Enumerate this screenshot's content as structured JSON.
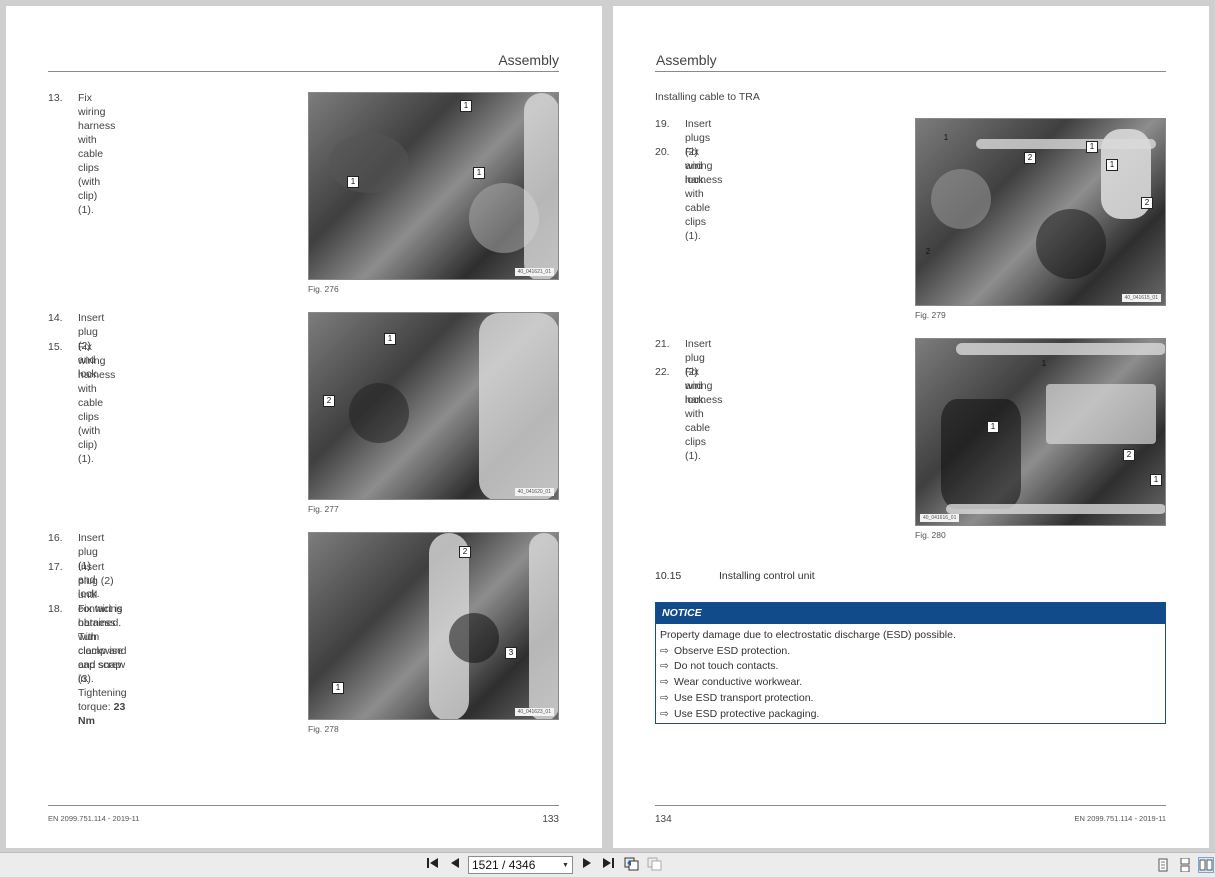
{
  "left_page": {
    "header": "Assembly",
    "steps": [
      {
        "num": "13.",
        "lines": [
          "Fix wiring harness with cable clips (with clip)",
          "(1)."
        ]
      },
      {
        "num": "14.",
        "lines": [
          "Insert plug (2) and lock."
        ]
      },
      {
        "num": "15.",
        "lines": [
          "Fix wiring harness with cable clips (with clip)",
          "(1)."
        ]
      },
      {
        "num": "16.",
        "lines": [
          "Insert plug (1) and lock."
        ]
      },
      {
        "num": "17.",
        "lines": [
          "Insert plug (2) until contact is obtained. Turn",
          "clockwise and snap in."
        ]
      },
      {
        "num": "18.",
        "lines": [
          "Fix wiring harness with clamp and cap screw",
          "(3)."
        ]
      }
    ],
    "torque_label": "Tightening torque: ",
    "torque_value": "23 Nm",
    "figures": [
      {
        "caption": "Fig. 276",
        "code": "40_041621_01",
        "callouts": [
          "1",
          "1",
          "1"
        ]
      },
      {
        "caption": "Fig. 277",
        "code": "40_041620_01",
        "callouts": [
          "1",
          "2"
        ]
      },
      {
        "caption": "Fig. 278",
        "code": "40_041623_01",
        "callouts": [
          "2",
          "3",
          "1"
        ]
      }
    ],
    "footer_doc": "EN 2099.751.114 - 2019-11",
    "footer_page": "133"
  },
  "right_page": {
    "header": "Assembly",
    "subhead": "Installing cable to TRA",
    "steps": [
      {
        "num": "19.",
        "lines": [
          "Insert plugs (2) and lock."
        ]
      },
      {
        "num": "20.",
        "lines": [
          "Fix wiring harness with cable clips (1)."
        ]
      },
      {
        "num": "21.",
        "lines": [
          "Insert plug (2) and lock."
        ]
      },
      {
        "num": "22.",
        "lines": [
          "Fix wiring harness with cable clips (1)."
        ]
      }
    ],
    "figures": [
      {
        "caption": "Fig. 279",
        "code": "40_041615_01",
        "callouts": [
          "1",
          "2",
          "1",
          "1",
          "2",
          "2"
        ]
      },
      {
        "caption": "Fig. 280",
        "code": "40_041616_01",
        "callouts": [
          "1",
          "1",
          "2",
          "1"
        ]
      }
    ],
    "section_num": "10.15",
    "section_title": "Installing control unit",
    "notice": {
      "title": "NOTICE",
      "intro": "Property damage due to electrostatic discharge (ESD) possible.",
      "arrow": "⇨",
      "items": [
        "Observe ESD protection.",
        "Do not touch contacts.",
        "Wear conductive workwear.",
        "Use ESD transport protection.",
        "Use ESD protective packaging."
      ]
    },
    "footer_doc": "EN 2099.751.114 - 2019-11",
    "footer_page": "134"
  },
  "toolbar": {
    "first_page_icon": "first-page-icon",
    "prev_page_icon": "prev-page-icon",
    "page_input_value": "1521 / 4346",
    "next_page_icon": "next-page-icon",
    "last_page_icon": "last-page-icon",
    "view_mode_icons": [
      "single-page-icon",
      "continuous-page-icon",
      "two-page-icon"
    ],
    "active_view": "two-page-icon"
  }
}
